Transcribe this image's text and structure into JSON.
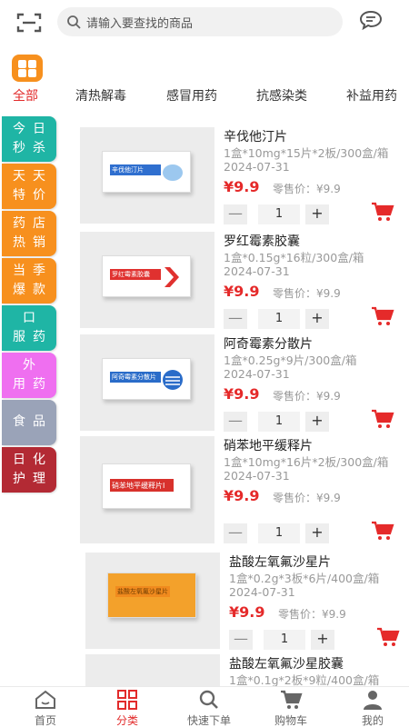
{
  "search": {
    "placeholder": "请输入要查找的商品"
  },
  "categories": [
    "全部",
    "清热解毒",
    "感冒用药",
    "抗感染类",
    "补益用药"
  ],
  "sidebar": [
    {
      "label": "今日秒杀",
      "color": "#1fb5a5"
    },
    {
      "label": "天天特价",
      "color": "#f7901e"
    },
    {
      "label": "药店热销",
      "color": "#f7901e"
    },
    {
      "label": "当季爆款",
      "color": "#f7901e"
    },
    {
      "label": "口服药",
      "color": "#1fb5a5"
    },
    {
      "label": "外用药",
      "color": "#ef6ff0"
    },
    {
      "label": "食品",
      "color": "#9aa3b8"
    },
    {
      "label": "日化护理",
      "color": "#b32a34"
    }
  ],
  "products": [
    {
      "name": "辛伐他汀片",
      "spec": "1盒*10mg*15片*2板/300盒/箱",
      "date": "2024-07-31",
      "price": "¥9.9",
      "retail": "零售价：¥9.9",
      "qty": "1",
      "pack_label": "辛伐他汀片",
      "pack_color": "#2f6fcf"
    },
    {
      "name": "罗红霉素胶囊",
      "spec": "1盒*0.15g*16粒/300盒/箱",
      "date": "2024-07-31",
      "price": "¥9.9",
      "retail": "零售价：¥9.9",
      "qty": "1",
      "pack_label": "罗红霉素胶囊",
      "pack_color": "#e0312f"
    },
    {
      "name": "阿奇霉素分散片",
      "spec": "1盒*0.25g*9片/300盒/箱",
      "date": "2024-07-31",
      "price": "¥9.9",
      "retail": "零售价：¥9.9",
      "qty": "1",
      "pack_label": "阿奇霉素分散片",
      "pack_color": "#2a6cc9"
    },
    {
      "name": "硝苯地平缓释片",
      "spec": "1盒*10mg*16片*2板/300盒/箱",
      "date": "2024-07-31",
      "price": "¥9.9",
      "retail": "零售价：¥9.9",
      "qty": "1",
      "pack_label": "硝苯地平缓释片Ⅰ",
      "pack_color": "#d8312c"
    },
    {
      "name": "盐酸左氧氟沙星片",
      "spec": "1盒*0.2g*3板*6片/400盒/箱",
      "date": "2024-07-31",
      "price": "¥9.9",
      "retail": "零售价：¥9.9",
      "qty": "1",
      "pack_label": "盐酸左氧氟沙星片",
      "pack_color": "#f08a1e"
    },
    {
      "name": "盐酸左氧氟沙星胶囊",
      "spec": "1盒*0.1g*2板*9粒/400盒/箱"
    }
  ],
  "nav": [
    {
      "label": "首页",
      "icon": "home-icon"
    },
    {
      "label": "分类",
      "icon": "category-icon"
    },
    {
      "label": "快速下单",
      "icon": "search-icon"
    },
    {
      "label": "购物车",
      "icon": "cart-icon"
    },
    {
      "label": "我的",
      "icon": "user-icon"
    }
  ],
  "colors": {
    "accent": "#e22b2b",
    "price": "#e52a2a",
    "brand_orange": "#f7901e"
  }
}
